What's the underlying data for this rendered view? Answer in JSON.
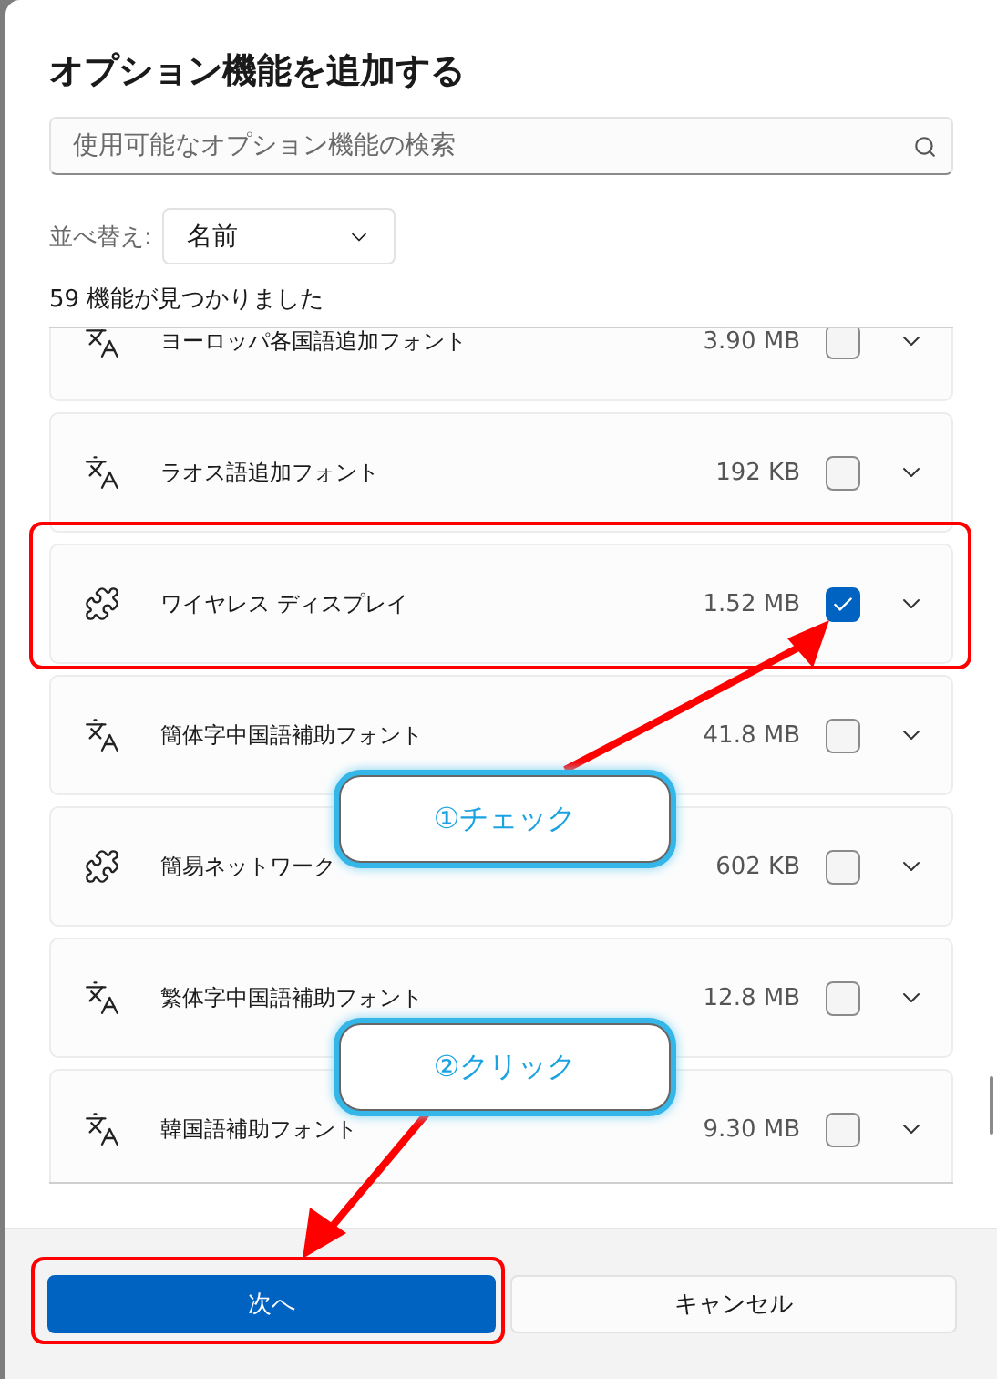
{
  "dialog": {
    "title": "オプション機能を追加する"
  },
  "search": {
    "placeholder": "使用可能なオプション機能の検索"
  },
  "sort": {
    "label": "並べ替え:",
    "value": "名前"
  },
  "result_count": "59 機能が見つかりました",
  "features": [
    {
      "kind": "font",
      "name": "ヨーロッパ各国語追加フォント",
      "size": "3.90 MB",
      "checked": false
    },
    {
      "kind": "font",
      "name": "ラオス語追加フォント",
      "size": "192 KB",
      "checked": false
    },
    {
      "kind": "feature",
      "name": "ワイヤレス ディスプレイ",
      "size": "1.52 MB",
      "checked": true
    },
    {
      "kind": "font",
      "name": "簡体字中国語補助フォント",
      "size": "41.8 MB",
      "checked": false
    },
    {
      "kind": "feature",
      "name": "簡易ネットワーク",
      "size": "602 KB",
      "checked": false
    },
    {
      "kind": "font",
      "name": "繁体字中国語補助フォント",
      "size": "12.8 MB",
      "checked": false
    },
    {
      "kind": "font",
      "name": "韓国語補助フォント",
      "size": "9.30 MB",
      "checked": false
    }
  ],
  "buttons": [
    {
      "label": "次へ",
      "primary": true
    },
    {
      "label": "キャンセル",
      "primary": false
    }
  ],
  "annotations": [
    {
      "text": "①チェック"
    },
    {
      "text": "②クリック"
    }
  ]
}
